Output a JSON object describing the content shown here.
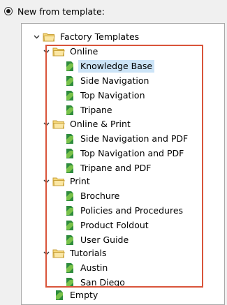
{
  "option": {
    "label": "New from template:"
  },
  "tree": {
    "root": "Factory Templates",
    "online": {
      "label": "Online",
      "items": [
        "Knowledge Base",
        "Side Navigation",
        "Top Navigation",
        "Tripane"
      ]
    },
    "online_print": {
      "label": "Online & Print",
      "items": [
        "Side Navigation and PDF",
        "Top Navigation and PDF",
        "Tripane and PDF"
      ]
    },
    "print": {
      "label": "Print",
      "items": [
        "Brochure",
        "Policies and Procedures",
        "Product Foldout",
        "User Guide"
      ]
    },
    "tutorials": {
      "label": "Tutorials",
      "items": [
        "Austin",
        "San Diego"
      ]
    },
    "empty": "Empty"
  },
  "colors": {
    "highlight_border": "#d9543a",
    "selection": "#cce4f7",
    "folder": "#f5d77a",
    "doc_green": "#2e8b3d"
  }
}
